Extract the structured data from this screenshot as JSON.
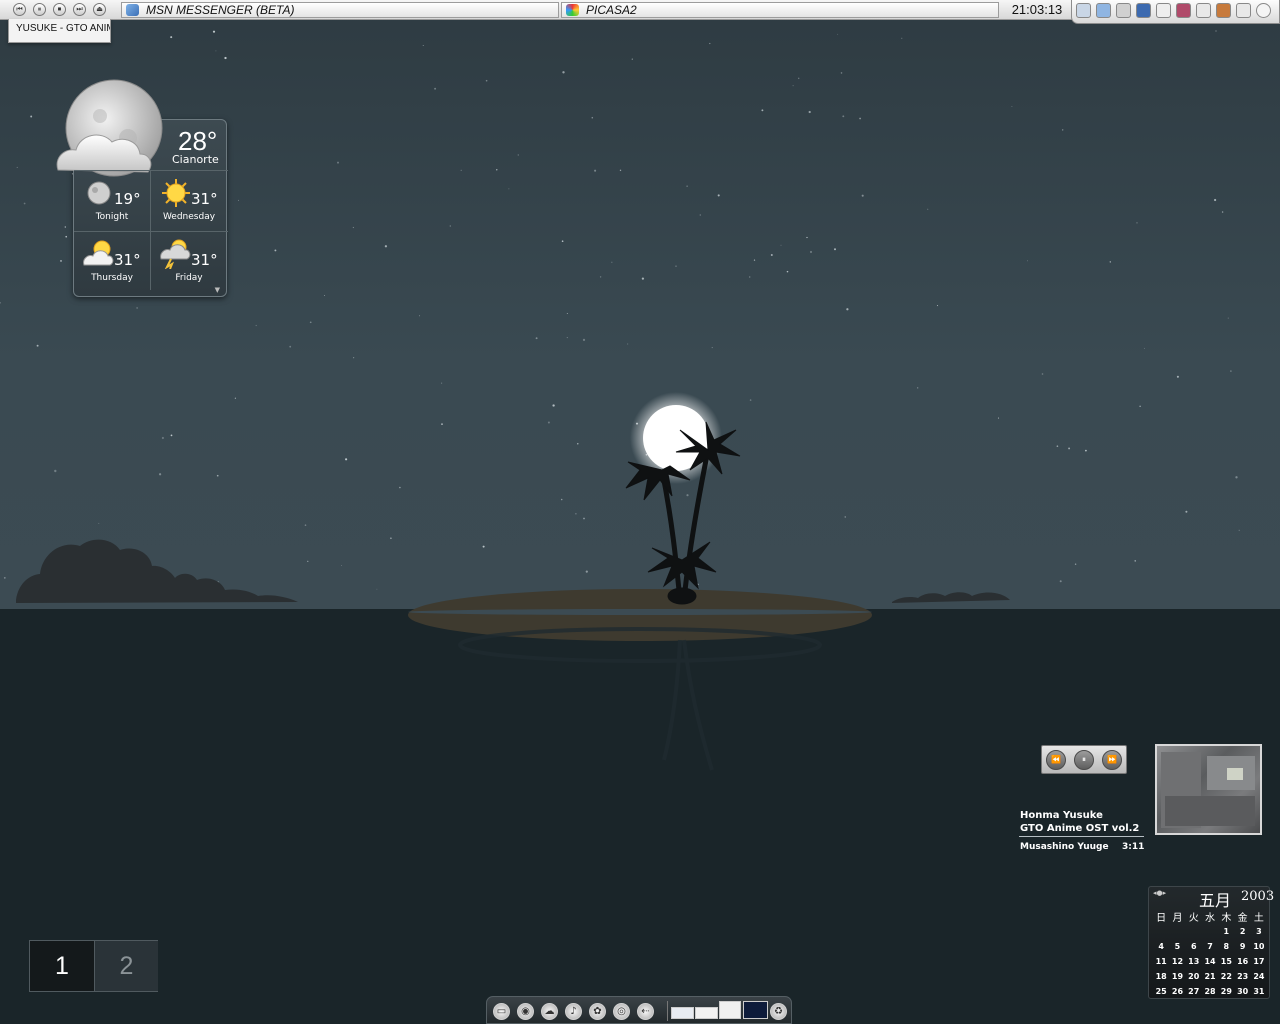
{
  "topbar": {
    "media_buttons": [
      "⏮",
      "⏸",
      "⏹",
      "⏭",
      "⏏"
    ],
    "tasks": [
      {
        "label": "MSN MESSENGER (BETA)",
        "icon": "msn-icon"
      },
      {
        "label": "PICASA2",
        "icon": "picasa-icon"
      }
    ],
    "clock": "21:03:13",
    "tray_icons": [
      "network-icon",
      "triangle-app-icon",
      "drive-icon",
      "browser-icon",
      "music-note-icon",
      "media-app-icon",
      "checkmark-icon",
      "paint-icon",
      "speaker-icon"
    ],
    "now_playing_tab": "YUSUKE - GTO ANIME O"
  },
  "weather": {
    "current_temp": "28°",
    "city": "Cianorte",
    "current_icon": "moon-cloud-icon",
    "forecast": [
      {
        "day": "Tonight",
        "temp": "19°",
        "icon": "moon-icon"
      },
      {
        "day": "Wednesday",
        "temp": "31°",
        "icon": "sun-icon"
      },
      {
        "day": "Thursday",
        "temp": "31°",
        "icon": "partly-cloudy-icon"
      },
      {
        "day": "Friday",
        "temp": "31°",
        "icon": "thunderstorm-icon"
      }
    ]
  },
  "player": {
    "buttons": [
      "⏪",
      "⏸",
      "⏩"
    ],
    "artist": "Honma Yusuke",
    "album": "GTO Anime OST vol.2",
    "track": "Musashino Yuuge",
    "time": "3:11"
  },
  "calendar": {
    "nav": "◂●▸",
    "month": "五月",
    "year": "2003",
    "weekdays": [
      "日",
      "月",
      "火",
      "水",
      "木",
      "金",
      "土"
    ],
    "leading_blanks": 4,
    "days": [
      "1",
      "2",
      "3",
      "4",
      "5",
      "6",
      "7",
      "8",
      "9",
      "10",
      "11",
      "12",
      "13",
      "14",
      "15",
      "16",
      "17",
      "18",
      "19",
      "20",
      "21",
      "22",
      "23",
      "24",
      "25",
      "26",
      "27",
      "28",
      "29",
      "30",
      "31"
    ]
  },
  "virtual_desktops": {
    "desktops": [
      "1",
      "2"
    ],
    "active": "1"
  },
  "dock": {
    "items": [
      {
        "name": "computer-icon",
        "glyph": "▭"
      },
      {
        "name": "disc-icon",
        "glyph": "◉"
      },
      {
        "name": "cloud-icon",
        "glyph": "☁"
      },
      {
        "name": "music-icon",
        "glyph": "♪"
      },
      {
        "name": "butterfly-icon",
        "glyph": "✿"
      },
      {
        "name": "target-icon",
        "glyph": "◎"
      },
      {
        "name": "back-arrow-icon",
        "glyph": "⇠"
      }
    ],
    "recycle": {
      "name": "recycle-icon",
      "glyph": "♻"
    }
  },
  "colors": {
    "sky": "#36444b",
    "sea": "#1a2529",
    "moon": "#ffffff",
    "sand": "#3e3a2f"
  }
}
